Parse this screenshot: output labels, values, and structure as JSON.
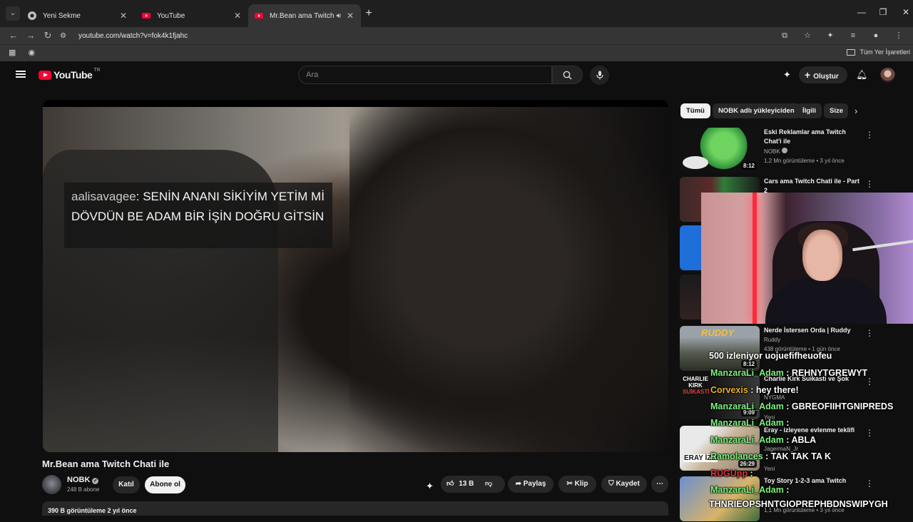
{
  "browser": {
    "tabs": [
      {
        "title": "Yeni Sekme",
        "active": false
      },
      {
        "title": "YouTube",
        "active": false
      },
      {
        "title": "Mr.Bean ama Twitch Chati i",
        "active": true
      }
    ],
    "url": "youtube.com/watch?v=fok4k1fjahc",
    "bookmarks_right": "Tüm Yer İşaretleri"
  },
  "youtube": {
    "logo": "YouTube",
    "country": "TR",
    "search_placeholder": "Ara",
    "create_label": "Oluştur"
  },
  "video": {
    "overlay_user": "aalisavagee",
    "overlay_text": ": SENİN ANANI SİKİYİM YETİM Mİ DÖVDÜN BE ADAM BİR İŞİN DOĞRU GİTSİN",
    "title": "Mr.Bean ama Twitch Chati ile",
    "channel": "NOBK",
    "subscribers": "248 B abone",
    "join_label": "Katıl",
    "subscribe_label": "Abone ol",
    "likes": "13 B",
    "share_label": "Paylaş",
    "clip_label": "Klip",
    "save_label": "Kaydet",
    "stats": "390 B görüntüleme  2 yıl önce"
  },
  "sidebar": {
    "chips": [
      "Tümü",
      "NOBK adlı yükleyiciden",
      "İlgili",
      "Size"
    ],
    "recommendations": [
      {
        "title": "Eski Reklamlar ama Twitch Chat'i ile",
        "channel": "NOBK",
        "meta": "1,2 Mn görüntüleme • 3 yıl önce",
        "duration": "8:12"
      },
      {
        "title": "Cars ama Twitch Chati ile - Part 2",
        "channel": "",
        "meta": "",
        "duration": ""
      },
      {
        "title": "",
        "channel": "",
        "meta": "",
        "duration": ""
      },
      {
        "title": "",
        "channel": "",
        "meta": "",
        "duration": ""
      },
      {
        "title": "Nerde İstersen Orda | Ruddy",
        "channel": "Ruddy",
        "meta": "438 görüntüleme • 1 gün önce",
        "duration": "8:12"
      },
      {
        "title": "Charlie Kirk Suikasti ve Şok",
        "channel": "NYGMA",
        "meta": "Yeni",
        "duration": "9:09"
      },
      {
        "title": "Eray - izleyene evlenme teklifi",
        "channel": "JagermaN_Jr",
        "meta": "Yeni",
        "duration": "26:29"
      },
      {
        "title": "Toy Story 1-2-3 ama Twitch",
        "channel": "",
        "meta": "1,1 Mn görüntüleme • 3 yıl önce",
        "duration": ""
      }
    ]
  },
  "stream_chat": {
    "viewers": "500 izleniyor uojuefifheuofeu",
    "lines": [
      {
        "user": "ManzaraLi_Adam",
        "msg": " : REHNYTGREWYT",
        "color": "#7ff27f"
      },
      {
        "user": "Corvexis",
        "msg": " : hey there!",
        "color": "#e8b320"
      },
      {
        "user": "ManzaraLi_Adam",
        "msg": " : GBREOFIIHTGNIPREDS",
        "color": "#7ff27f"
      },
      {
        "user": "ManzaraLi_Adam",
        "msg": " :",
        "color": "#7ff27f"
      },
      {
        "user": "ManzaraLi_Adam",
        "msg": " : ABLA",
        "color": "#7ff27f"
      },
      {
        "user": "Ramolances",
        "msg": " : TAK TAK TA K",
        "color": "#7ff27f"
      },
      {
        "user": "RUGUpp",
        "msg": " :",
        "color": "#e03535"
      },
      {
        "user": "ManzaraLi_Adam",
        "msg": " :",
        "color": "#7ff27f"
      },
      {
        "user": "",
        "msg": "THNRIEOPSHNTGIOPREPHBDNSWIPYGH",
        "color": "#ffffff"
      }
    ]
  }
}
